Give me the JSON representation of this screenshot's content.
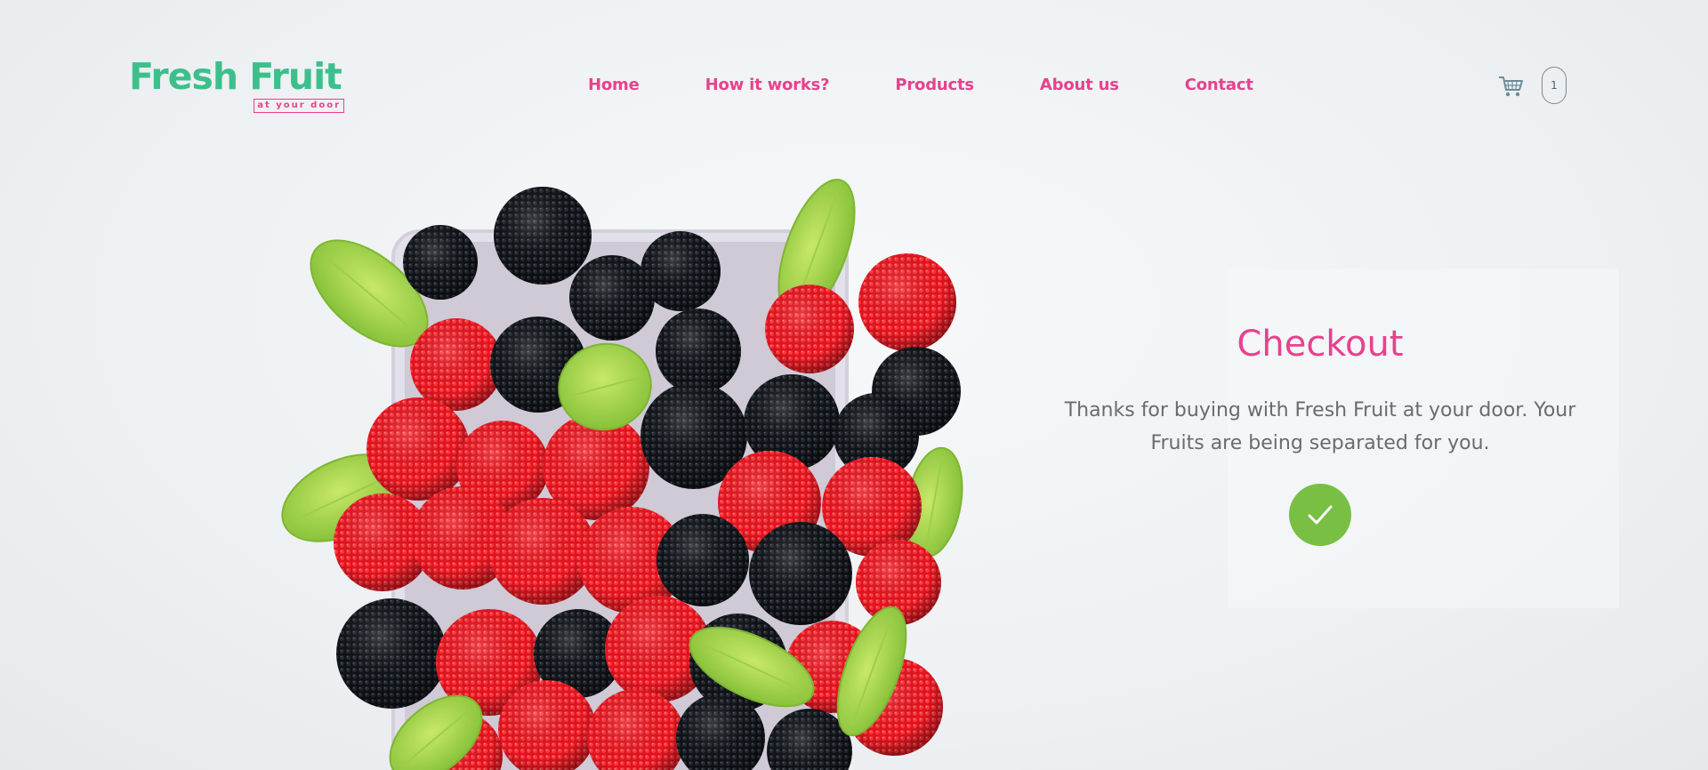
{
  "brand": {
    "name": "Fresh Fruit",
    "tagline": "at your door",
    "primary_color": "#3dbf8c",
    "accent_color": "#e8418d"
  },
  "nav": {
    "items": [
      {
        "label": "Home"
      },
      {
        "label": "How it works?"
      },
      {
        "label": "Products"
      },
      {
        "label": "About us"
      },
      {
        "label": "Contact"
      }
    ]
  },
  "cart": {
    "icon": "cart-icon",
    "count": "1"
  },
  "hero": {
    "image": "berries-candy-basket"
  },
  "checkout": {
    "title": "Checkout",
    "message": "Thanks for buying with Fresh Fruit at your door. Your Fruits are being separated for you.",
    "status_icon": "check-icon",
    "status_color": "#79bf43"
  }
}
